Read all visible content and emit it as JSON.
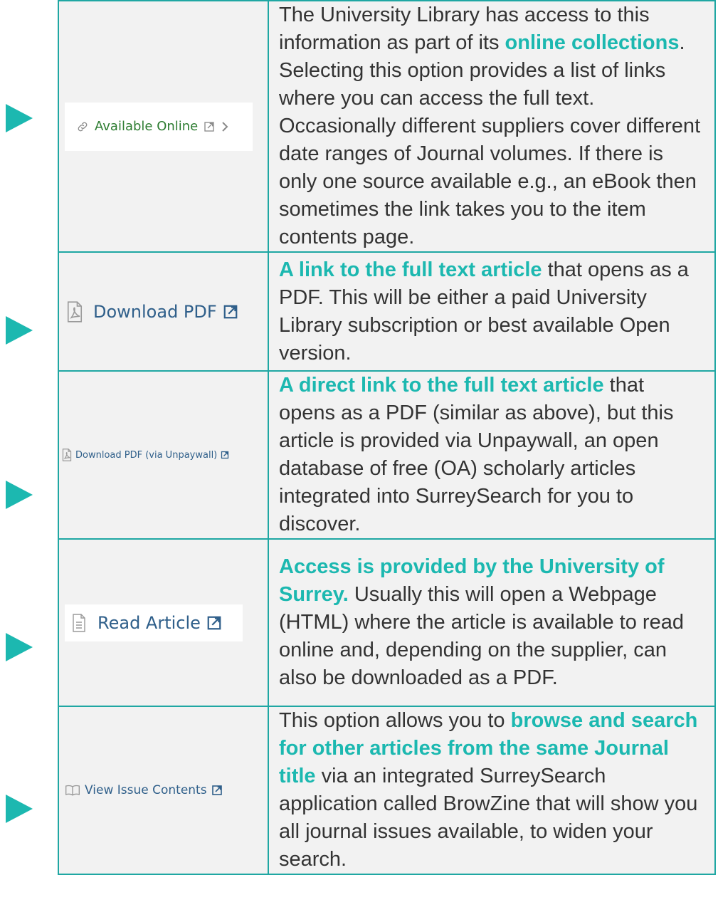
{
  "rows": [
    {
      "button": {
        "label": "Available Online",
        "icon": "link-icon",
        "trail_icon": "chevron-right-icon",
        "color": "#2e7d32"
      },
      "desc": {
        "p1": "The University Library has access to this information as part of its ",
        "h1": "online collections",
        "p2": ". Selecting this option provides a list of links where you can access the full text. Occasionally different suppliers cover different date ranges of Journal volumes. If there is only one source available e.g., an eBook then sometimes the link takes you to the item contents page."
      }
    },
    {
      "button": {
        "label": "Download PDF",
        "icon": "pdf-icon",
        "color": "#2f5f8a"
      },
      "desc": {
        "h1": "A link to the full text article",
        "p1": " that opens as a PDF. This will be either a paid University Library subscription or best available Open version."
      }
    },
    {
      "button": {
        "label": "Download PDF (via Unpaywall)",
        "icon": "pdf-icon",
        "color": "#2f5f8a"
      },
      "desc": {
        "h1": "A direct link to the full text article",
        "p1": " that opens as a PDF (similar as above), but this article is provided via Unpaywall, an open database of free (OA) scholarly articles integrated into SurreySearch for you to discover."
      }
    },
    {
      "button": {
        "label": "Read Article",
        "icon": "document-icon",
        "color": "#2f5f8a"
      },
      "desc": {
        "h1": "Access is provided by the University of Surrey.",
        "p1": " Usually this will open a Webpage (HTML) where the article is available to read online and, depending on the supplier, can also be downloaded as a PDF."
      }
    },
    {
      "button": {
        "label": "View Issue Contents",
        "icon": "open-book-icon",
        "color": "#2f5f8a"
      },
      "desc": {
        "p1": "This option allows you to ",
        "h1": "browse and search for other articles from the same Journal title",
        "p2": " via an integrated SurreySearch application called BrowZine that will show you all journal issues available, to widen your search."
      }
    }
  ],
  "colors": {
    "accent": "#1cb8b0",
    "border": "#1fa7a3",
    "cell_bg": "#f2f2f2",
    "text": "#333333"
  }
}
